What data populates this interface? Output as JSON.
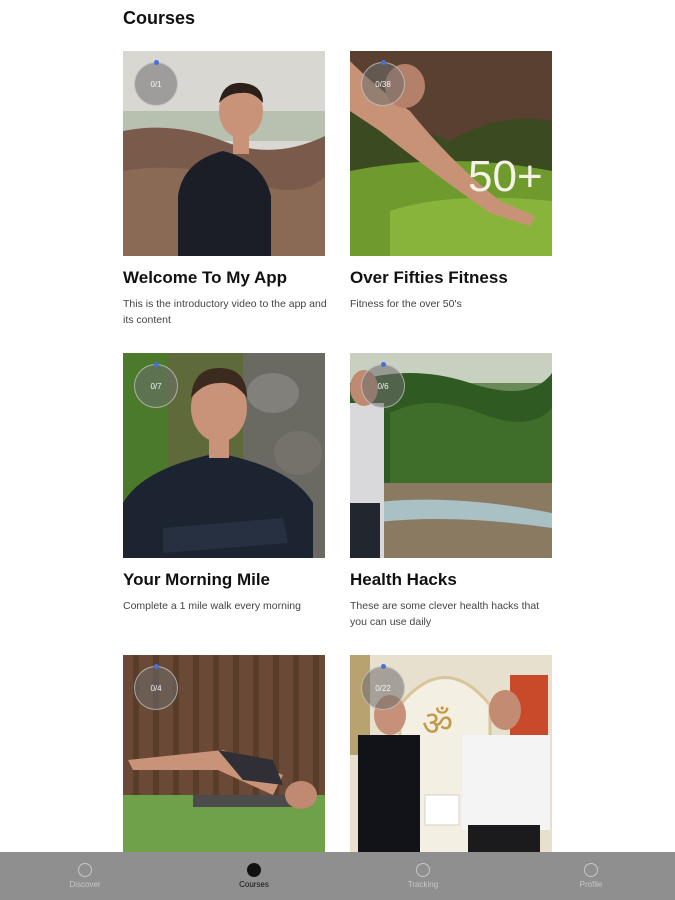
{
  "page": {
    "title": "Courses"
  },
  "courses": [
    {
      "title": "Welcome To My App",
      "description": "This is the introductory video to the app and its content",
      "progress": "0/1"
    },
    {
      "title": "Over Fifties Fitness",
      "description": "Fitness for the over 50's",
      "progress": "0/38",
      "overlay_text": "50+"
    },
    {
      "title": "Your Morning Mile",
      "description": "Complete a 1 mile walk every morning",
      "progress": "0/7"
    },
    {
      "title": "Health Hacks",
      "description": "These are some clever health hacks that you can use daily",
      "progress": "0/6"
    },
    {
      "title": "",
      "description": "",
      "progress": "0/4"
    },
    {
      "title": "",
      "description": "",
      "progress": "0/22"
    }
  ],
  "nav": {
    "items": [
      {
        "label": "Discover",
        "icon": "compass-icon"
      },
      {
        "label": "Courses",
        "icon": "courses-icon",
        "active": true
      },
      {
        "label": "Tracking",
        "icon": "check-circle-icon"
      },
      {
        "label": "Profile",
        "icon": "user-icon"
      }
    ]
  }
}
